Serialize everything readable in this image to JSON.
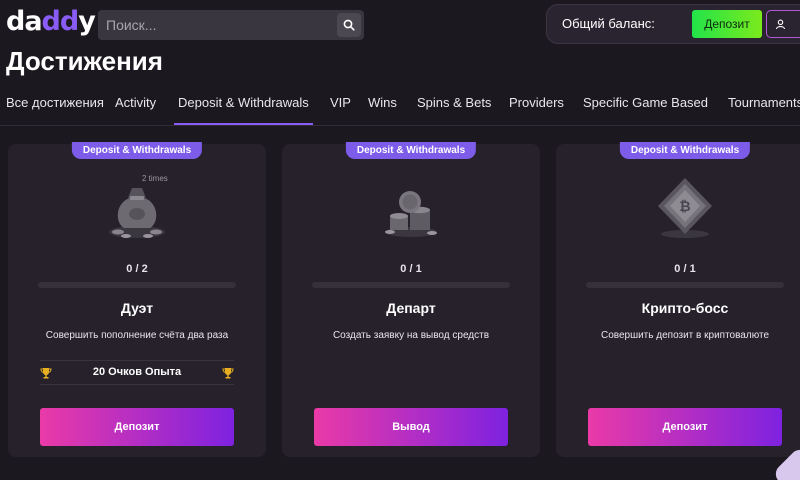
{
  "header": {
    "logo_prefix": "da",
    "logo_accent": "dd",
    "logo_suffix": "y",
    "search_placeholder": "Поиск...",
    "balance_label": "Общий баланс:",
    "deposit_button": "Депозит"
  },
  "page": {
    "title": "Достижения"
  },
  "tabs": [
    {
      "label": "Все достижения",
      "active": false
    },
    {
      "label": "Activity",
      "active": false
    },
    {
      "label": "Deposit & Withdrawals",
      "active": true
    },
    {
      "label": "VIP",
      "active": false
    },
    {
      "label": "Wins",
      "active": false
    },
    {
      "label": "Spins & Bets",
      "active": false
    },
    {
      "label": "Providers",
      "active": false
    },
    {
      "label": "Specific Game Based",
      "active": false
    },
    {
      "label": "Tournaments",
      "active": false
    }
  ],
  "cards": [
    {
      "badge": "Deposit & Withdrawals",
      "image_overlay": "2 times",
      "progress": "0 / 2",
      "progress_fraction": 0,
      "name": "Дуэт",
      "description": "Совершить пополнение счёта два раза",
      "reward": "20 Очков Опыта",
      "button": "Депозит",
      "icon": "money-bag-icon"
    },
    {
      "badge": "Deposit & Withdrawals",
      "progress": "0 / 1",
      "progress_fraction": 0,
      "name": "Департ",
      "description": "Создать заявку на вывод средств",
      "button": "Вывод",
      "icon": "coin-stack-icon"
    },
    {
      "badge": "Deposit & Withdrawals",
      "progress": "0 / 1",
      "progress_fraction": 0,
      "name": "Крипто-босс",
      "description": "Совершить депозит в криптовалюте",
      "button": "Депозит",
      "icon": "bitcoin-diamond-icon"
    }
  ],
  "colors": {
    "accent": "#8a5cf6",
    "badge": "#7c5ce8",
    "deposit_green": "#22e34a",
    "button_gradient_start": "#ea3aa7",
    "button_gradient_end": "#7e22e0",
    "trophy": "#e8b021"
  }
}
